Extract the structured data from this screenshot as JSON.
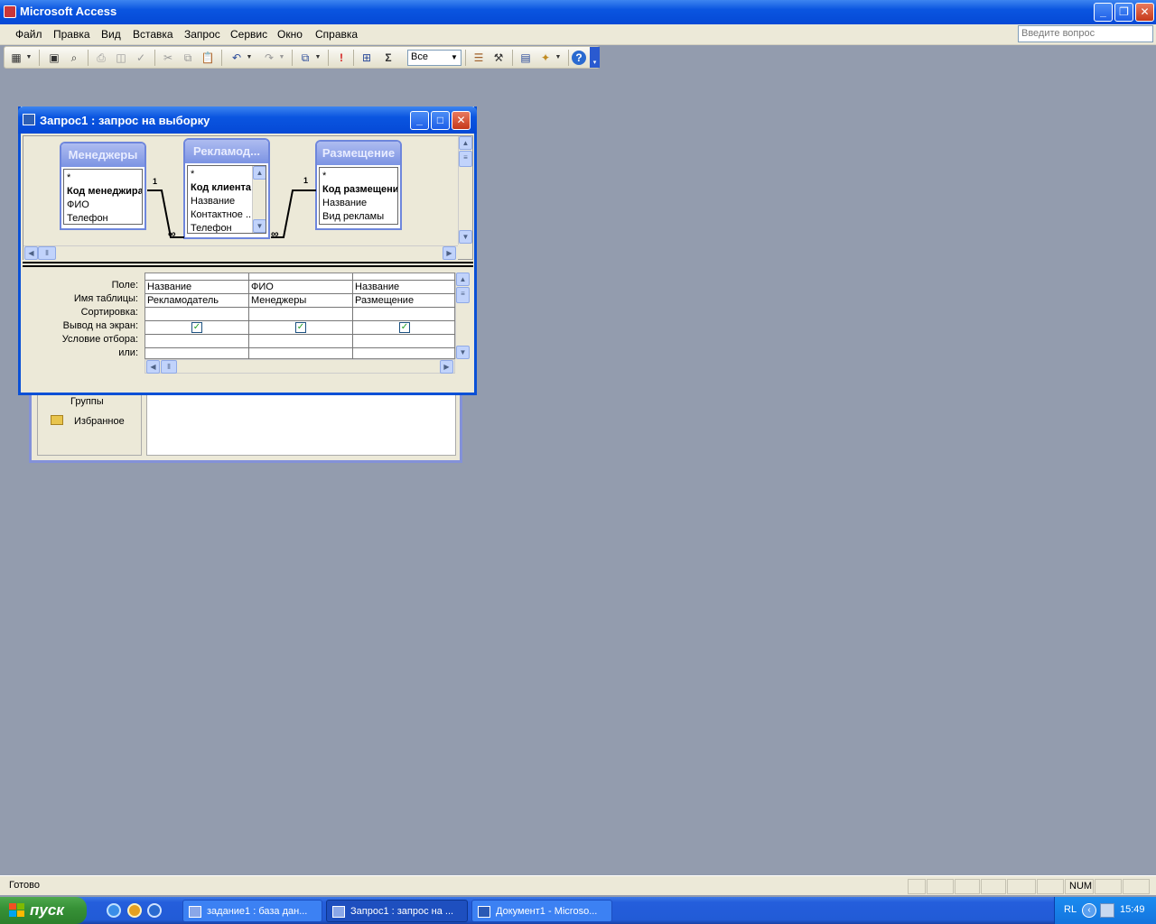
{
  "app": {
    "title": "Microsoft Access"
  },
  "menu": [
    "Файл",
    "Правка",
    "Вид",
    "Вставка",
    "Запрос",
    "Сервис",
    "Окно",
    "Справка"
  ],
  "help_placeholder": "Введите вопрос",
  "toolbar": {
    "top_values": "Все"
  },
  "db_window": {
    "groups_label": "Группы",
    "favorites_label": "Избранное"
  },
  "query_window": {
    "title": "Запрос1 : запрос на выборку",
    "tables": [
      {
        "name": "Менеджеры",
        "fields": [
          "*",
          "Код менеджира",
          "ФИО",
          "Телефон"
        ],
        "bold_index": 1
      },
      {
        "name": "Рекламод...",
        "fields": [
          "*",
          "Код клиента",
          "Название",
          "Контактное ...",
          "Телефон"
        ],
        "bold_index": 1
      },
      {
        "name": "Размещение",
        "fields": [
          "*",
          "Код размещения",
          "Название",
          "Вид рекламы"
        ],
        "bold_index": 1
      }
    ],
    "relations": [
      {
        "one": "1",
        "many": "∞"
      },
      {
        "one": "1",
        "many": "∞"
      }
    ],
    "grid_rows": [
      "Поле:",
      "Имя таблицы:",
      "Сортировка:",
      "Вывод на экран:",
      "Условие отбора:",
      "или:"
    ],
    "columns": [
      {
        "field": "Название",
        "table": "Рекламодатель",
        "show": true
      },
      {
        "field": "ФИО",
        "table": "Менеджеры",
        "show": true
      },
      {
        "field": "Название",
        "table": "Размещение",
        "show": true
      }
    ]
  },
  "status": {
    "text": "Готово",
    "num": "NUM"
  },
  "taskbar": {
    "start": "пуск",
    "tasks": [
      "задание1 : база дан...",
      "Запрос1 : запрос на ...",
      "Документ1 - Microso..."
    ],
    "lang": "RL",
    "clock": "15:49"
  }
}
